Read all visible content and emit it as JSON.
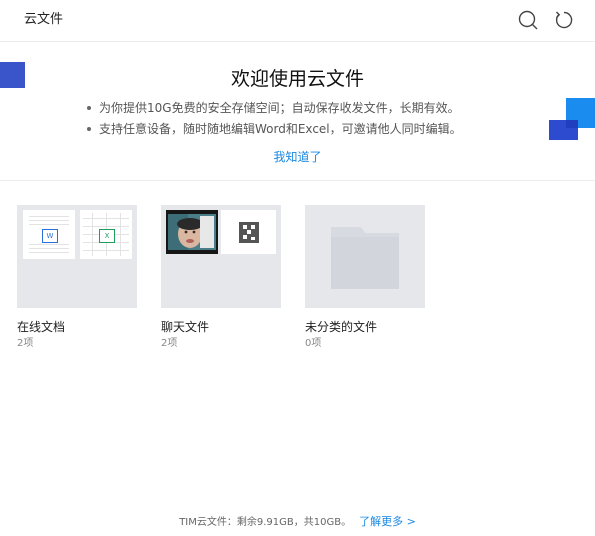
{
  "header": {
    "title": "云文件",
    "search_icon": "search-icon",
    "refresh_icon": "refresh-icon"
  },
  "banner": {
    "title": "欢迎使用云文件",
    "bullets": [
      "为你提供10G免费的安全存储空间；自动保存收发文件，长期有效。",
      "支持任意设备，随时随地编辑Word和Excel，可邀请他人同时编辑。"
    ],
    "dismiss_label": "我知道了"
  },
  "folders": [
    {
      "name": "在线文档",
      "count": "2项"
    },
    {
      "name": "聊天文件",
      "count": "2项"
    },
    {
      "name": "未分类的文件",
      "count": "0项"
    }
  ],
  "footer": {
    "storage_text": "TIM云文件：剩余9.91GB，共10GB。",
    "learn_more": "了解更多 >"
  },
  "colors": {
    "accent": "#1b88e3",
    "deco_blue": "#1a8cf0",
    "deco_indigo": "#3a55c9",
    "word_badge": "#2b6fd6",
    "excel_badge": "#1e9e5a"
  }
}
